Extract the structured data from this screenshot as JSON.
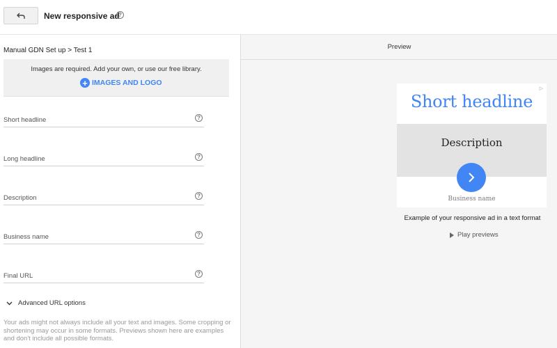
{
  "header": {
    "back_icon": "back-arrow-icon",
    "title": "New responsive ad"
  },
  "left": {
    "breadcrumb": "Manual GDN Set up > Test 1",
    "images": {
      "required_text": "Images are required. Add your own, or use our free library.",
      "button_label": "IMAGES AND LOGO"
    },
    "fields": [
      {
        "label": "Short headline"
      },
      {
        "label": "Long headline"
      },
      {
        "label": "Description"
      },
      {
        "label": "Business name"
      },
      {
        "label": "Final URL"
      }
    ],
    "advanced_url_label": "Advanced URL options",
    "note": "Your ads might not always include all your text and images. Some cropping or shortening may occur in some formats. Previews shown here are examples and don't include all possible formats."
  },
  "preview": {
    "header": "Preview",
    "ad": {
      "headline": "Short headline",
      "description": "Description",
      "business_name": "Business name"
    },
    "example_text": "Example of your responsive ad in a text format",
    "play_label": "Play previews"
  },
  "colors": {
    "accent": "#4285f4",
    "panel_bg": "#f5f5f5"
  }
}
